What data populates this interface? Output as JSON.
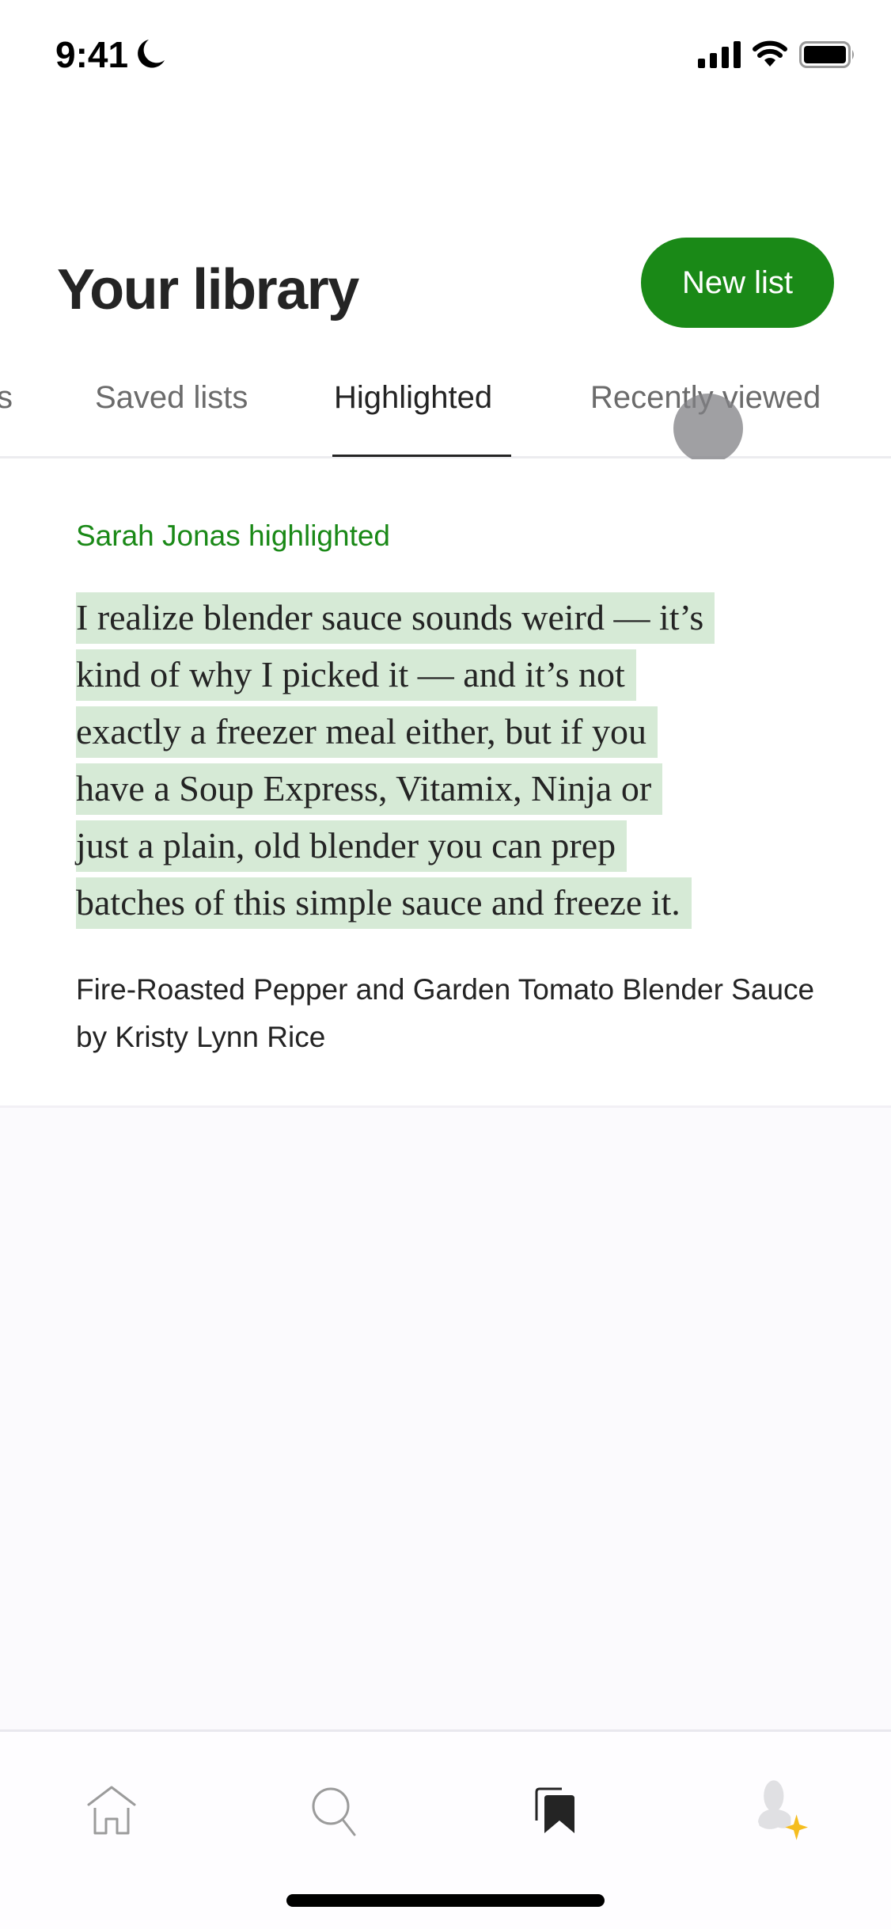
{
  "status_bar": {
    "time": "9:41",
    "focus_icon": "moon-icon",
    "signal_icon": "cellular-signal-icon",
    "wifi_icon": "wifi-icon",
    "battery_icon": "battery-icon"
  },
  "header": {
    "title": "Your library",
    "new_list_label": "New list"
  },
  "tabs": [
    {
      "label": "Your lists",
      "visible_text": "s",
      "active": false
    },
    {
      "label": "Saved lists",
      "visible_text": "Saved lists",
      "active": false
    },
    {
      "label": "Highlighted",
      "visible_text": "Highlighted",
      "active": true
    },
    {
      "label": "Recently viewed",
      "visible_text": "Recently viewed",
      "active": false
    }
  ],
  "highlight": {
    "highlighter": "Sarah Jonas highlighted",
    "quote_lines": [
      "I realize blender sauce sounds weird — it’s",
      "kind of why I picked it — and it’s not",
      "exactly a freezer meal either, but if you",
      "have a Soup Express, Vitamix, Ninja or",
      "just a plain, old blender you can prep",
      "batches of this simple sauce and freeze it."
    ],
    "source": "Fire-Roasted Pepper and Garden Tomato Blender Sauce by Kristy Lynn Rice"
  },
  "bottom_nav": [
    {
      "name": "home",
      "icon": "home-icon",
      "active": false
    },
    {
      "name": "search",
      "icon": "search-icon",
      "active": false
    },
    {
      "name": "library",
      "icon": "bookmarks-icon",
      "active": true
    },
    {
      "name": "profile",
      "icon": "profile-icon",
      "active": false
    }
  ],
  "colors": {
    "brand_green": "#1a8917",
    "highlight_bg": "#d6ead6",
    "text_primary": "#242424",
    "text_secondary": "#6b6b6b",
    "star_accent": "#f5bd1f"
  }
}
